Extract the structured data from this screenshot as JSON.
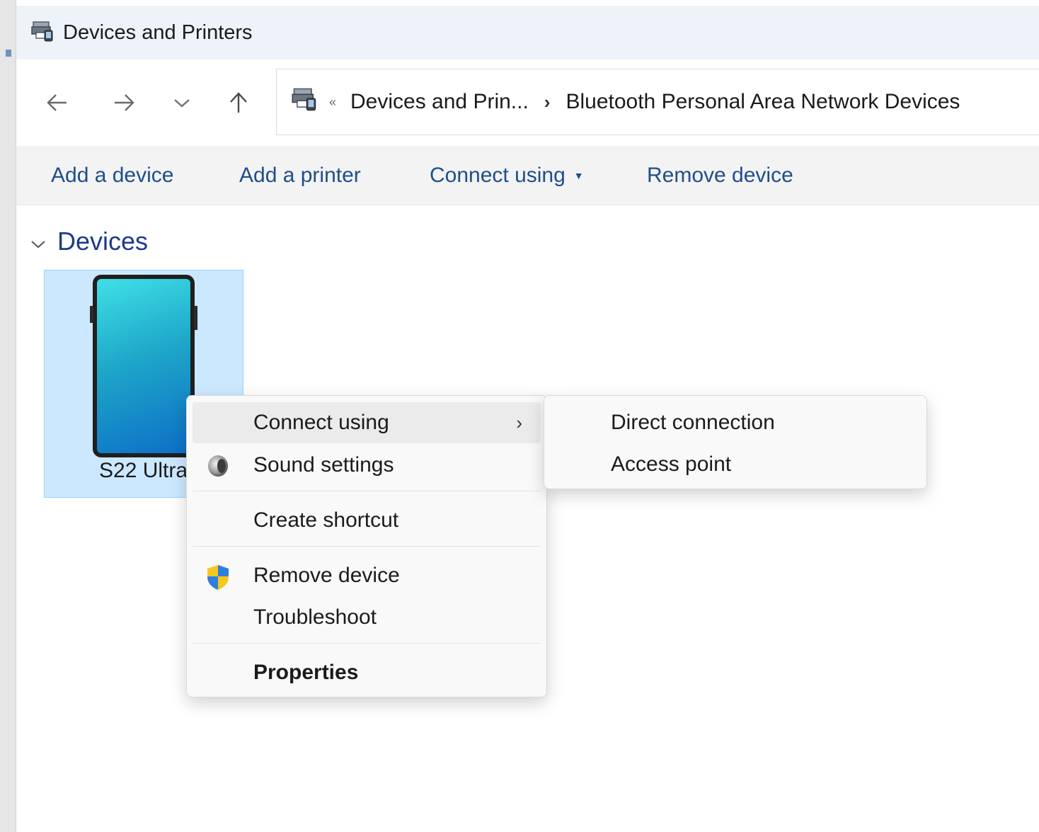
{
  "window": {
    "title": "Devices and Printers"
  },
  "addressbar": {
    "overflow": "«",
    "crumbs": [
      "Devices and Prin...",
      "Bluetooth Personal Area Network Devices"
    ],
    "separator": "›"
  },
  "commandbar": {
    "add_device": "Add a device",
    "add_printer": "Add a printer",
    "connect_using": "Connect using",
    "remove_device": "Remove device"
  },
  "group": {
    "label": "Devices"
  },
  "device": {
    "name": "S22 Ultra",
    "icon": "smartphone-icon"
  },
  "context_menu": {
    "items": [
      {
        "label": "Connect using",
        "icon": null,
        "has_submenu": true
      },
      {
        "label": "Sound settings",
        "icon": "speaker-icon"
      },
      {
        "label": "Create shortcut",
        "icon": null
      },
      {
        "label": "Remove device",
        "icon": "uac-shield-icon"
      },
      {
        "label": "Troubleshoot",
        "icon": null
      },
      {
        "label": "Properties",
        "icon": null,
        "bold": true
      }
    ]
  },
  "submenu": {
    "items": [
      {
        "label": "Direct connection"
      },
      {
        "label": "Access point"
      }
    ]
  },
  "colors": {
    "accent_text": "#1e4e8c",
    "selection": "#cce8ff",
    "titlebar": "#eef3fa"
  }
}
